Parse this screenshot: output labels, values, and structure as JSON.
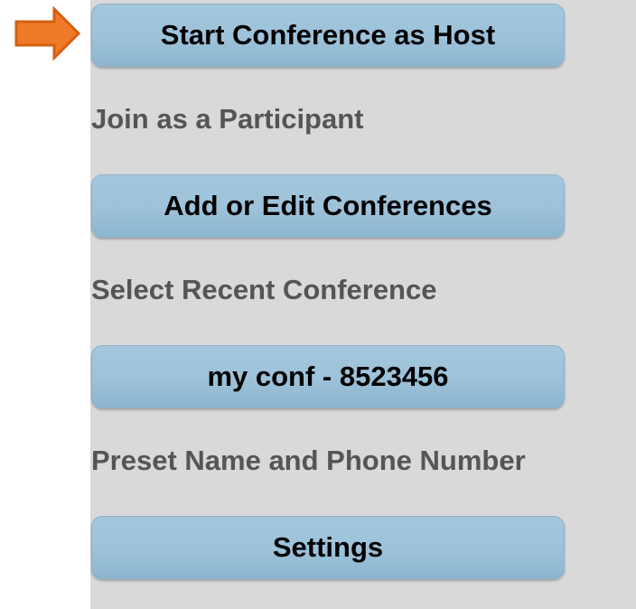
{
  "menu": {
    "start_host_label": "Start Conference as Host",
    "join_participant_label": "Join as a Participant",
    "add_edit_label": "Add or Edit Conferences",
    "select_recent_label": "Select Recent Conference",
    "recent_conference_label": "my conf - 8523456",
    "preset_label": "Preset Name and Phone Number",
    "settings_label": "Settings"
  },
  "pointer": {
    "icon": "right-arrow-icon",
    "color": "#f07a2a"
  },
  "colors": {
    "panel": "#d9d9d9",
    "button": "#9dc2d9",
    "label_text": "#555555"
  }
}
